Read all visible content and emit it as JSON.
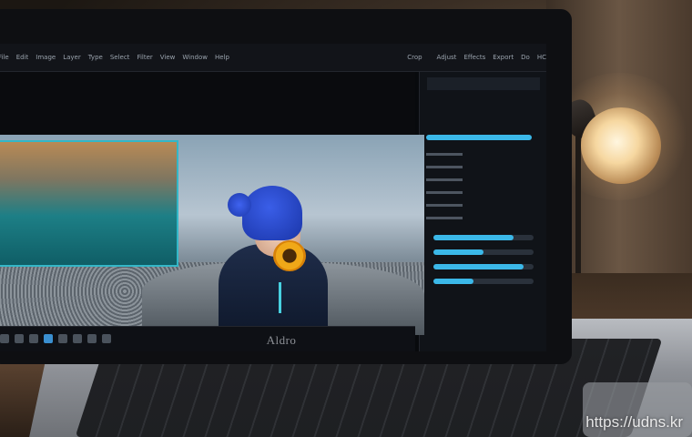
{
  "photo": {
    "subject": "",
    "colors": {
      "hat": "#1f3fc2",
      "jacket": "#1b2a48",
      "accent": "#3bb8e8",
      "flower": "#f0a818"
    }
  },
  "editor": {
    "top_menu": [
      "File",
      "Edit",
      "Image",
      "Layer",
      "Type",
      "Select",
      "Filter",
      "View",
      "Window",
      "Help"
    ],
    "toolbar_items": [
      "Crop",
      "Adjust",
      "Effects",
      "Export",
      "Do",
      "HC"
    ],
    "panel_rows": 6,
    "slider_levels": [
      0.8,
      0.5,
      0.9,
      0.4
    ]
  },
  "laptop": {
    "logo": "Aldro"
  },
  "watermark": "https://udns.kr"
}
